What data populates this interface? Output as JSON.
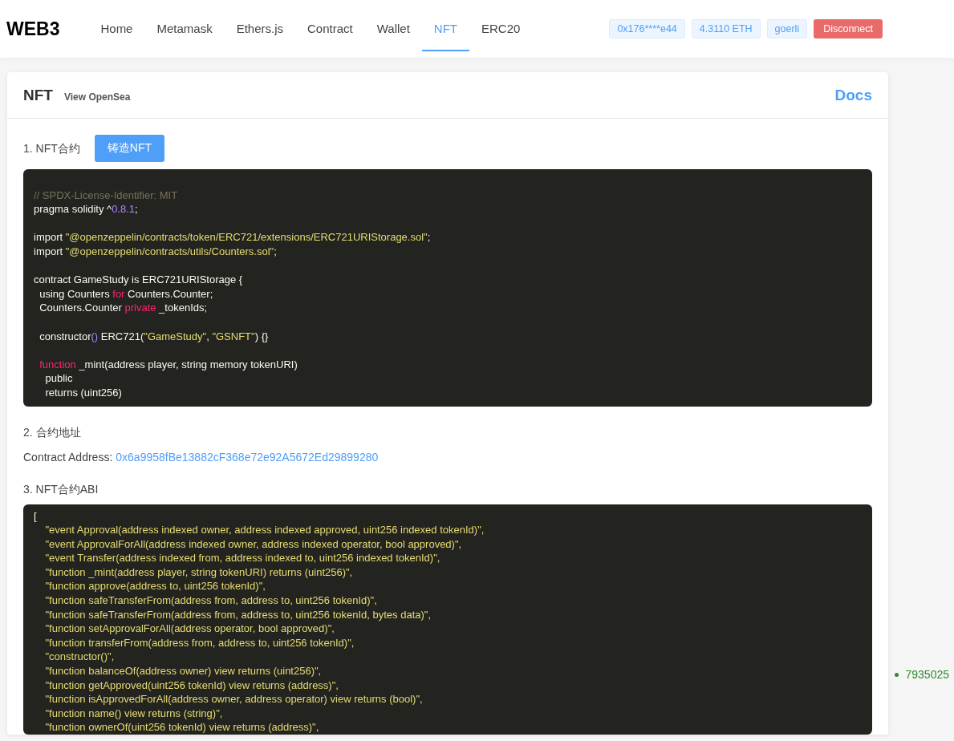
{
  "brand": "WEB3",
  "nav": [
    {
      "label": "Home",
      "selected": false
    },
    {
      "label": "Metamask",
      "selected": false
    },
    {
      "label": "Ethers.js",
      "selected": false
    },
    {
      "label": "Contract",
      "selected": false
    },
    {
      "label": "Wallet",
      "selected": false
    },
    {
      "label": "NFT",
      "selected": true
    },
    {
      "label": "ERC20",
      "selected": false
    }
  ],
  "account": {
    "address": "0x176****e44",
    "balance": "4.3110 ETH",
    "network": "goerli",
    "disconnect": "Disconnect"
  },
  "card": {
    "title": "NFT",
    "link": "View OpenSea",
    "docs": "Docs"
  },
  "section_1": {
    "label": "1. NFT合约",
    "button": "铸造NFT"
  },
  "source_code": [
    {
      "kind": "blank"
    },
    {
      "kind": "code",
      "tokens": [
        {
          "text": "// SPDX-License-Identifier: MIT",
          "kind": "comment"
        }
      ]
    },
    {
      "kind": "code",
      "tokens": [
        {
          "text": "pragma solidity ^",
          "kind": "plain"
        },
        {
          "text": "0.8.1",
          "kind": "number"
        },
        {
          "text": ";",
          "kind": "plain"
        }
      ]
    },
    {
      "kind": "blank"
    },
    {
      "kind": "code",
      "tokens": [
        {
          "text": "import ",
          "kind": "plain"
        },
        {
          "text": "\"@openzeppelin/contracts/token/ERC721/extensions/ERC721URIStorage.sol\"",
          "kind": "string"
        },
        {
          "text": ";",
          "kind": "plain"
        }
      ]
    },
    {
      "kind": "code",
      "tokens": [
        {
          "text": "import ",
          "kind": "plain"
        },
        {
          "text": "\"@openzeppelin/contracts/utils/Counters.sol\"",
          "kind": "string"
        },
        {
          "text": ";",
          "kind": "plain"
        }
      ]
    },
    {
      "kind": "blank"
    },
    {
      "kind": "code",
      "tokens": [
        {
          "text": "contract GameStudy is ERC721URIStorage {",
          "kind": "plain"
        }
      ]
    },
    {
      "kind": "code",
      "tokens": [
        {
          "text": "  using Counters ",
          "kind": "plain"
        },
        {
          "text": "for",
          "kind": "keyword"
        },
        {
          "text": " Counters.Counter;",
          "kind": "plain"
        }
      ]
    },
    {
      "kind": "code",
      "tokens": [
        {
          "text": "  Counters.Counter ",
          "kind": "plain"
        },
        {
          "text": "private",
          "kind": "keyword"
        },
        {
          "text": " _tokenIds;",
          "kind": "plain"
        }
      ]
    },
    {
      "kind": "blank"
    },
    {
      "kind": "code",
      "tokens": [
        {
          "text": "  constructor",
          "kind": "plain"
        },
        {
          "text": "()",
          "kind": "number"
        },
        {
          "text": " ERC721(",
          "kind": "plain"
        },
        {
          "text": "\"GameStudy\"",
          "kind": "string"
        },
        {
          "text": ", ",
          "kind": "plain"
        },
        {
          "text": "\"GSNFT\"",
          "kind": "string"
        },
        {
          "text": ") {}",
          "kind": "plain"
        }
      ]
    },
    {
      "kind": "blank"
    },
    {
      "kind": "code",
      "tokens": [
        {
          "text": "  function",
          "kind": "keyword"
        },
        {
          "text": " _mint(address player, string memory tokenURI)",
          "kind": "plain"
        }
      ]
    },
    {
      "kind": "code",
      "tokens": [
        {
          "text": "    public",
          "kind": "plain"
        }
      ]
    },
    {
      "kind": "code",
      "tokens": [
        {
          "text": "    returns (uint256)",
          "kind": "plain"
        }
      ]
    }
  ],
  "section_2": {
    "label": "2. 合约地址",
    "address_label": "Contract Address:",
    "address": "0x6a9958fBe13882cF368e72e92A5672Ed29899280"
  },
  "section_3": {
    "label": "3. NFT合约ABI"
  },
  "abi": [
    {
      "text": "[",
      "kind": "punct"
    },
    {
      "text": "    \"event Approval(address indexed owner, address indexed approved, uint256 indexed tokenId)\",",
      "kind": "string"
    },
    {
      "text": "    \"event ApprovalForAll(address indexed owner, address indexed operator, bool approved)\",",
      "kind": "string"
    },
    {
      "text": "    \"event Transfer(address indexed from, address indexed to, uint256 indexed tokenId)\",",
      "kind": "string"
    },
    {
      "text": "    \"function _mint(address player, string tokenURI) returns (uint256)\",",
      "kind": "string"
    },
    {
      "text": "    \"function approve(address to, uint256 tokenId)\",",
      "kind": "string"
    },
    {
      "text": "    \"function safeTransferFrom(address from, address to, uint256 tokenId)\",",
      "kind": "string"
    },
    {
      "text": "    \"function safeTransferFrom(address from, address to, uint256 tokenId, bytes data)\",",
      "kind": "string"
    },
    {
      "text": "    \"function setApprovalForAll(address operator, bool approved)\",",
      "kind": "string"
    },
    {
      "text": "    \"function transferFrom(address from, address to, uint256 tokenId)\",",
      "kind": "string"
    },
    {
      "text": "    \"constructor()\",",
      "kind": "string"
    },
    {
      "text": "    \"function balanceOf(address owner) view returns (uint256)\",",
      "kind": "string"
    },
    {
      "text": "    \"function getApproved(uint256 tokenId) view returns (address)\",",
      "kind": "string"
    },
    {
      "text": "    \"function isApprovedForAll(address owner, address operator) view returns (bool)\",",
      "kind": "string"
    },
    {
      "text": "    \"function name() view returns (string)\",",
      "kind": "string"
    },
    {
      "text": "    \"function ownerOf(uint256 tokenId) view returns (address)\",",
      "kind": "string"
    }
  ],
  "block_number": "7935025"
}
